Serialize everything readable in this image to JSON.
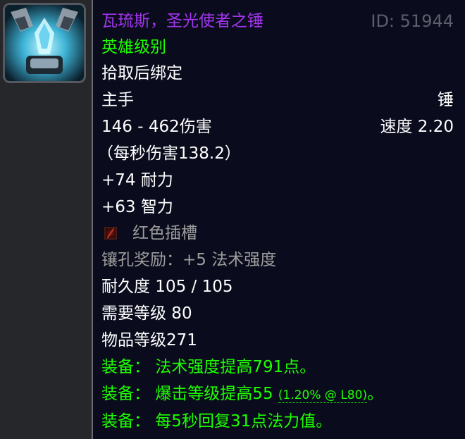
{
  "item": {
    "name": "瓦琉斯，圣光使者之锤",
    "id_label": "ID: 51944",
    "quality": "英雄级别",
    "binding": "拾取后绑定",
    "slot": "主手",
    "type": "锤",
    "damage": "146 - 462伤害",
    "speed": "速度 2.20",
    "dps": "（每秒伤害138.2）",
    "stamina": "+74 耐力",
    "intellect": "+63 智力",
    "socket_label": "红色插槽",
    "socket_bonus": "镶孔奖励：+5 法术强度",
    "durability": "耐久度 105 / 105",
    "required_level": "需要等级 80",
    "item_level": "物品等级271",
    "equip_1": "装备：  法术强度提高791点。",
    "equip_2_main": "装备：  爆击等级提高55",
    "equip_2_note": "(1.20% @ L80)",
    "equip_2_end": "。",
    "equip_3": "装备：  每5秒回复31点法力值。"
  },
  "colors": {
    "epic_name": "#a335ee",
    "green_text": "#1eff00",
    "grey_text": "#9d9d9d",
    "tooltip_bg": "#0a0c1d"
  },
  "icons": {
    "item_icon": "mace-icon",
    "socket_icon": "red-socket-icon"
  }
}
